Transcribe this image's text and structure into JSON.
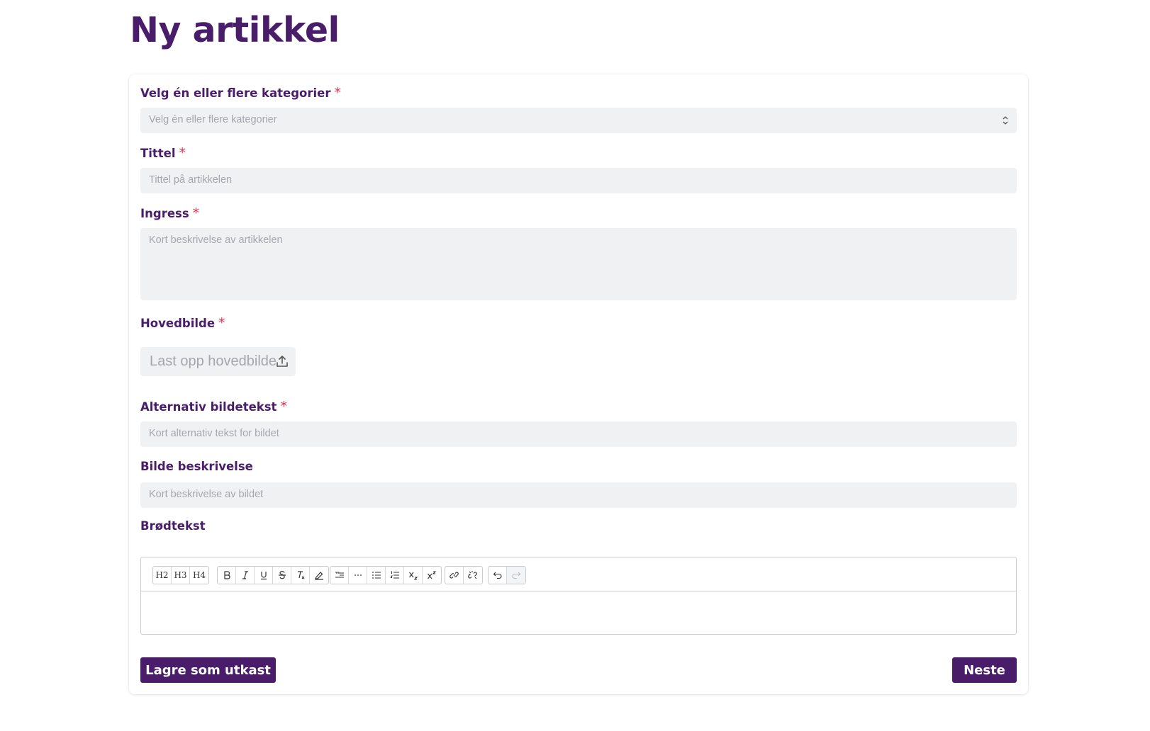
{
  "page": {
    "title": "Ny artikkel"
  },
  "form": {
    "categories": {
      "label": "Velg én eller flere kategorier",
      "required_mark": "*",
      "placeholder": "Velg én eller flere kategorier"
    },
    "title": {
      "label": "Tittel",
      "required_mark": "*",
      "placeholder": "Tittel på artikkelen"
    },
    "ingress": {
      "label": "Ingress",
      "required_mark": "*",
      "placeholder": "Kort beskrivelse av artikkelen"
    },
    "main_image": {
      "label": "Hovedbilde",
      "required_mark": "*",
      "upload_label": "Last opp hovedbilde",
      "upload_icon": "upload-icon"
    },
    "alt_text": {
      "label": "Alternativ bildetekst",
      "required_mark": "*",
      "placeholder": "Kort alternativ tekst for bildet"
    },
    "image_description": {
      "label": "Bilde beskrivelse",
      "placeholder": "Kort beskrivelse av bildet"
    },
    "body": {
      "label": "Brødtekst",
      "toolbar": {
        "headings": [
          "H2",
          "H3",
          "H4"
        ],
        "format_icons": [
          "bold-icon",
          "italic-icon",
          "underline-icon",
          "strikethrough-icon",
          "clear-format-icon",
          "highlight-icon"
        ],
        "block_icons": [
          "blockquote-icon",
          "horizontal-rule-icon",
          "bullet-list-icon",
          "ordered-list-icon",
          "subscript-icon",
          "superscript-icon"
        ],
        "link_icons": [
          "link-icon",
          "unlink-icon"
        ],
        "history_icons": [
          "undo-icon",
          "redo-icon"
        ]
      }
    }
  },
  "actions": {
    "save_draft": "Lagre som utkast",
    "next": "Neste"
  },
  "colors": {
    "brand": "#4a1d6a",
    "required": "#e0334f",
    "field_bg": "#f0f1f3",
    "placeholder": "#a3a7ae"
  }
}
